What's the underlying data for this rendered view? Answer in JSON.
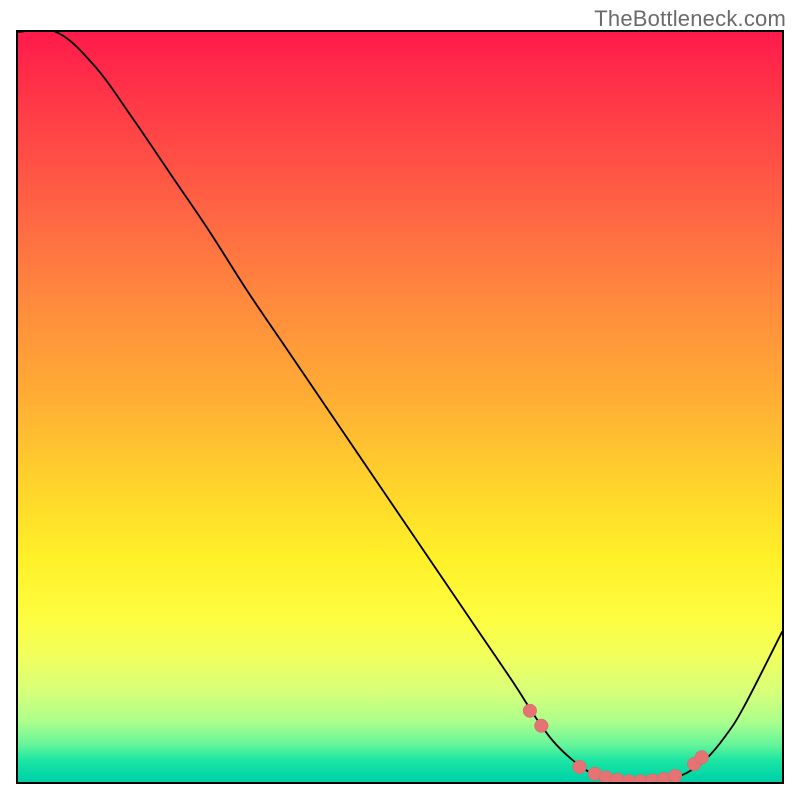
{
  "attribution": "TheBottleneck.com",
  "chart_data": {
    "type": "line",
    "title": "",
    "xlabel": "",
    "ylabel": "",
    "x": [
      0.0,
      0.05,
      0.1,
      0.15,
      0.2,
      0.25,
      0.3,
      0.35,
      0.4,
      0.45,
      0.5,
      0.55,
      0.6,
      0.65,
      0.675,
      0.7,
      0.725,
      0.75,
      0.775,
      0.8,
      0.825,
      0.85,
      0.875,
      0.9,
      0.925,
      0.95,
      1.0
    ],
    "values": [
      1.0,
      1.0,
      0.955,
      0.885,
      0.81,
      0.735,
      0.655,
      0.58,
      0.505,
      0.43,
      0.355,
      0.28,
      0.205,
      0.13,
      0.09,
      0.055,
      0.03,
      0.012,
      0.004,
      0.0,
      0.0,
      0.003,
      0.012,
      0.03,
      0.06,
      0.1,
      0.2
    ],
    "xlim": [
      0,
      1
    ],
    "ylim": [
      0,
      1
    ],
    "markers": {
      "x": [
        0.67,
        0.685,
        0.735,
        0.755,
        0.77,
        0.785,
        0.8,
        0.815,
        0.83,
        0.845,
        0.86,
        0.885,
        0.895
      ],
      "y": [
        0.095,
        0.075,
        0.02,
        0.011,
        0.006,
        0.003,
        0.001,
        0.001,
        0.002,
        0.004,
        0.008,
        0.024,
        0.033
      ]
    },
    "style": {
      "curve_color": "#000000",
      "marker_color": "#e57373",
      "background_gradient": [
        "#ff1a4b",
        "#ffd22c",
        "#fdfd40",
        "#00cfa8"
      ]
    }
  }
}
